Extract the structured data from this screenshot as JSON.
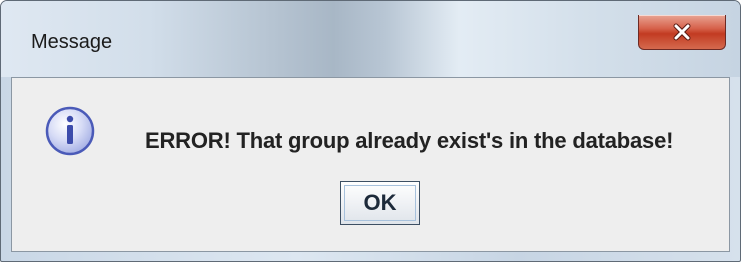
{
  "window": {
    "title": "Message"
  },
  "dialog": {
    "icon": "info-icon",
    "message": "ERROR! That group already exist's in the database!",
    "ok_label": "OK"
  },
  "colors": {
    "close_button": "#c23b22",
    "dialog_background": "#eeeeee",
    "icon_fill": "#c9cff2",
    "icon_stroke": "#4a5ab8"
  }
}
